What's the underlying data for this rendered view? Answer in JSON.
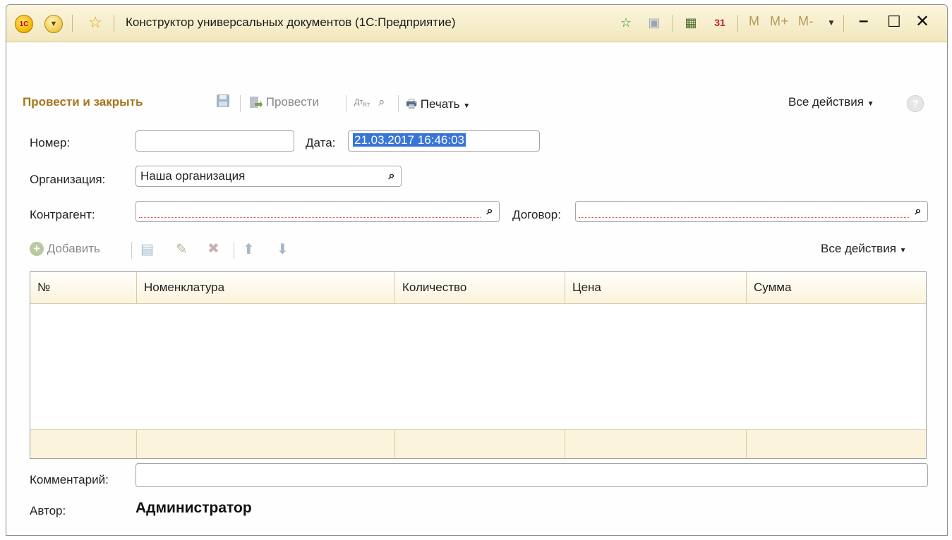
{
  "window": {
    "title": "Конструктор универсальных документов  (1С:Предприятие)",
    "logo_text": "1С",
    "memory_buttons": [
      "M",
      "M+",
      "M-"
    ]
  },
  "toolbar": {
    "post_and_close": "Провести и закрыть",
    "post": "Провести",
    "print": "Печать",
    "all_actions": "Все действия",
    "help": "?"
  },
  "form": {
    "number_label": "Номер:",
    "number_value": "",
    "date_label": "Дата:",
    "date_value": "21.03.2017 16:46:03",
    "organization_label": "Организация:",
    "organization_value": "Наша организация",
    "counterparty_label": "Контрагент:",
    "counterparty_value": "",
    "contract_label": "Договор:",
    "contract_value": "",
    "comment_label": "Комментарий:",
    "comment_value": "",
    "author_label": "Автор:",
    "author_value": "Администратор"
  },
  "table_toolbar": {
    "add": "Добавить",
    "all_actions": "Все действия"
  },
  "table": {
    "columns": [
      "№",
      "Номенклатура",
      "Количество",
      "Цена",
      "Сумма"
    ],
    "rows": []
  },
  "colors": {
    "accent": "#a7751d",
    "titlebar": "#f2e7bd",
    "selection": "#3875d7",
    "required_underline": "#e04848"
  }
}
